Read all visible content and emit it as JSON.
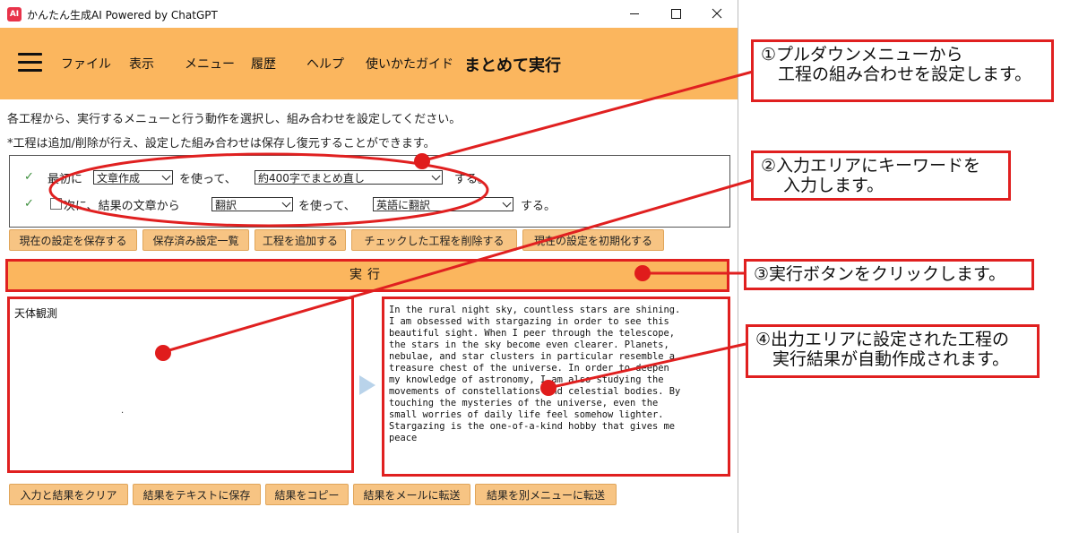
{
  "window": {
    "title": "かんたん生成AI Powered by ChatGPT",
    "icon_text": "AI",
    "controls": [
      "minimize-icon",
      "maximize-icon",
      "close-icon"
    ]
  },
  "header": {
    "menu": [
      "ファイル",
      "表示",
      "メニュー",
      "履歴",
      "ヘルプ",
      "使いかたガイド"
    ],
    "current": "まとめて実行",
    "bg_color": "#fbb65e"
  },
  "description": {
    "line1": "各工程から、実行するメニューと行う動作を選択し、組み合わせを設定してください。",
    "line2": "*工程は追加/削除が行え、設定した組み合わせは保存し復元することができます。"
  },
  "steps": [
    {
      "check": "✓",
      "prefix": "最初に",
      "menu_value": "文章作成",
      "middle": "を使って、",
      "action_value": "約400字でまとめ直し",
      "suffix": "する。",
      "has_checkbox": false
    },
    {
      "check": "✓",
      "prefix": "次に、結果の文章から",
      "menu_value": "翻訳",
      "middle": "を使って、",
      "action_value": "英語に翻訳",
      "suffix": "する。",
      "has_checkbox": true
    }
  ],
  "setting_buttons": [
    "現在の設定を保存する",
    "保存済み設定一覧",
    "工程を追加する",
    "チェックした工程を削除する",
    "現在の設定を初期化する"
  ],
  "run_button": "実行",
  "input": {
    "text": "天体観測"
  },
  "output": {
    "text": "In the rural night sky, countless stars are shining.\nI am obsessed with stargazing in order to see this\nbeautiful sight. When I peer through the telescope,\nthe stars in the sky become even clearer. Planets,\nnebulae, and star clusters in particular resemble a\ntreasure chest of the universe. In order to deepen\nmy knowledge of astronomy, I am also studying the\nmovements of constellations and celestial bodies. By\ntouching the mysteries of the universe, even the\nsmall worries of daily life feel somehow lighter.\nStargazing is the one-of-a-kind hobby that gives me\npeace"
  },
  "bottom_buttons": [
    "入力と結果をクリア",
    "結果をテキストに保存",
    "結果をコピー",
    "結果をメールに転送",
    "結果を別メニューに転送"
  ],
  "annotations": {
    "callout1": "①プルダウンメニューから\n　工程の組み合わせを設定します。",
    "callout2": "②入力エリアにキーワードを\n　 入力します。",
    "callout3": "③実行ボタンをクリックします。",
    "callout4": "④出力エリアに設定された工程の\n　実行結果が自動作成されます。",
    "color": "#e02020"
  }
}
